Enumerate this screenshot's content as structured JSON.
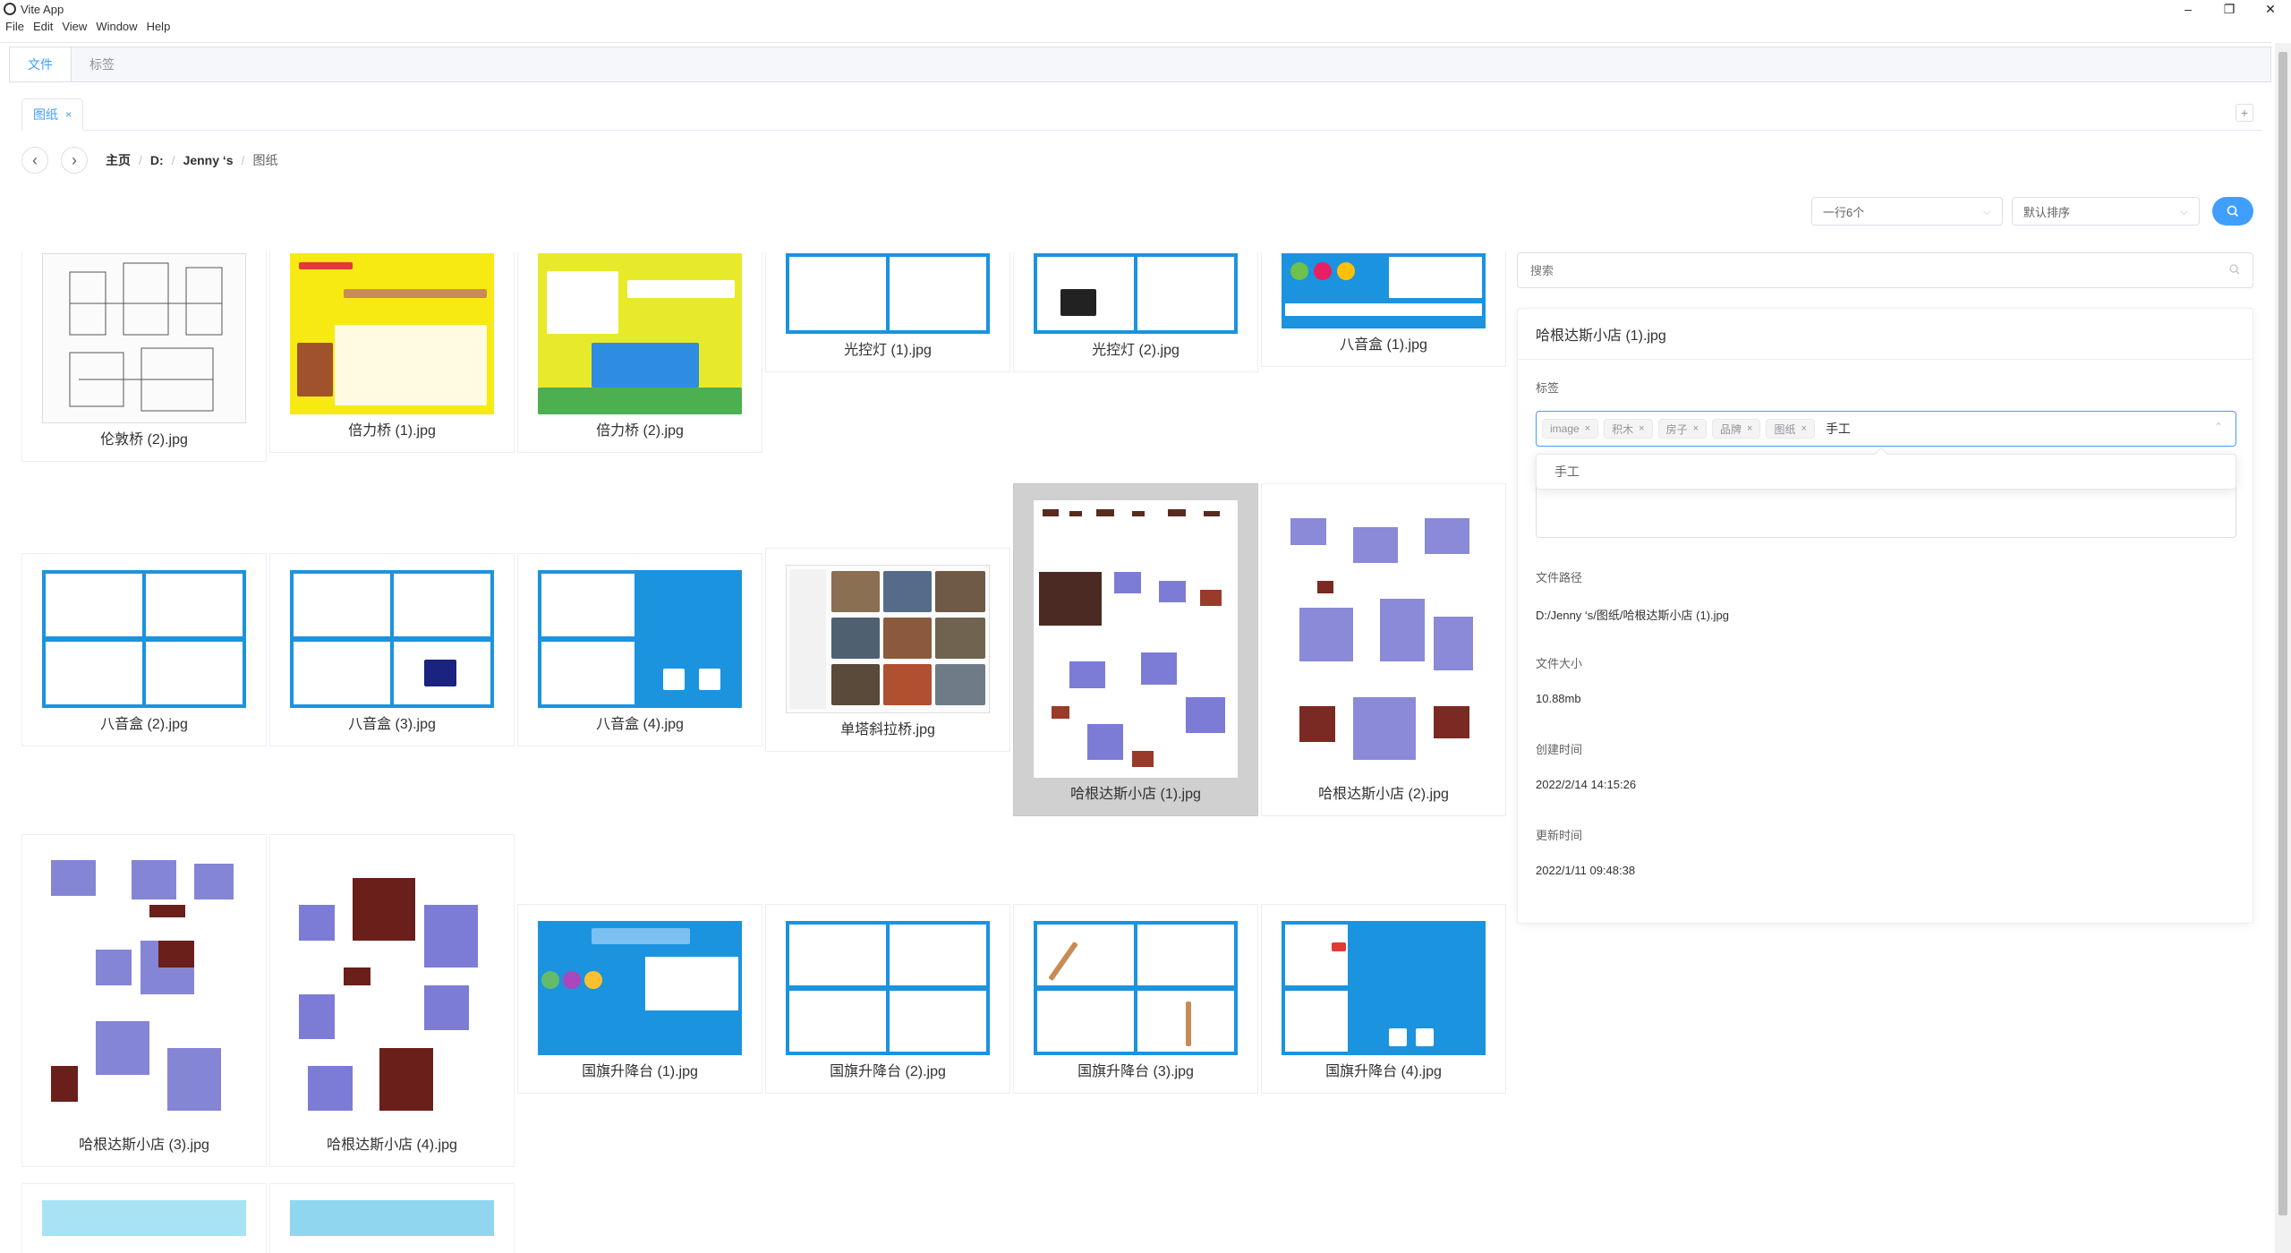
{
  "window": {
    "title": "Vite App",
    "minimize": "–",
    "restore": "❐",
    "close": "✕"
  },
  "menu": [
    "File",
    "Edit",
    "View",
    "Window",
    "Help"
  ],
  "main_tabs": [
    {
      "label": "文件",
      "active": true
    },
    {
      "label": "标签",
      "active": false
    }
  ],
  "content_tab": {
    "label": "图纸",
    "close": "×"
  },
  "add_tab": "+",
  "nav": {
    "back": "‹",
    "forward": "›"
  },
  "breadcrumb": [
    "主页",
    "D:",
    "Jenny ‘s",
    "图纸"
  ],
  "breadcrumb_sep": "/",
  "controls": {
    "per_row": "一行6个",
    "sort": "默认排序",
    "search_icon": "search-icon"
  },
  "files": [
    {
      "name": "伦敦桥 (2).jpg",
      "style": "white"
    },
    {
      "name": "倍力桥 (1).jpg",
      "style": "yellow"
    },
    {
      "name": "倍力桥 (2).jpg",
      "style": "green"
    },
    {
      "name": "光控灯 (1).jpg",
      "style": "blue"
    },
    {
      "name": "光控灯 (2).jpg",
      "style": "blue"
    },
    {
      "name": "八音盒 (1).jpg",
      "style": "blue"
    },
    {
      "name": "八音盒 (2).jpg",
      "style": "blue"
    },
    {
      "name": "八音盒 (3).jpg",
      "style": "blue"
    },
    {
      "name": "八音盒 (4).jpg",
      "style": "blue"
    },
    {
      "name": "单塔斜拉桥.jpg",
      "style": "white"
    },
    {
      "name": "哈根达斯小店 (1).jpg",
      "style": "white",
      "selected": true
    },
    {
      "name": "哈根达斯小店 (2).jpg",
      "style": "white"
    },
    {
      "name": "哈根达斯小店 (3).jpg",
      "style": "white"
    },
    {
      "name": "哈根达斯小店 (4).jpg",
      "style": "white"
    },
    {
      "name": "国旗升降台 (1).jpg",
      "style": "blue"
    },
    {
      "name": "国旗升降台 (2).jpg",
      "style": "blue"
    },
    {
      "name": "国旗升降台 (3).jpg",
      "style": "blue"
    },
    {
      "name": "国旗升降台 (4).jpg",
      "style": "blue"
    }
  ],
  "panel": {
    "search_placeholder": "搜索",
    "file_title": "哈根达斯小店 (1).jpg",
    "tags_label": "标签",
    "tags": [
      "image",
      "积木",
      "房子",
      "品牌",
      "图纸"
    ],
    "tag_input": "手工",
    "suggestion": "手工",
    "path_label": "文件路径",
    "path": "D:/Jenny ‘s/图纸/哈根达斯小店 (1).jpg",
    "size_label": "文件大小",
    "size": "10.88mb",
    "created_label": "创建时间",
    "created": "2022/2/14 14:15:26",
    "updated_label": "更新时间",
    "updated": "2022/1/11 09:48:38"
  },
  "colors": {
    "accent": "#409eff",
    "border": "#dcdfe6",
    "selected_card": "#d0d0d0",
    "blueprint": "#1c93de"
  }
}
